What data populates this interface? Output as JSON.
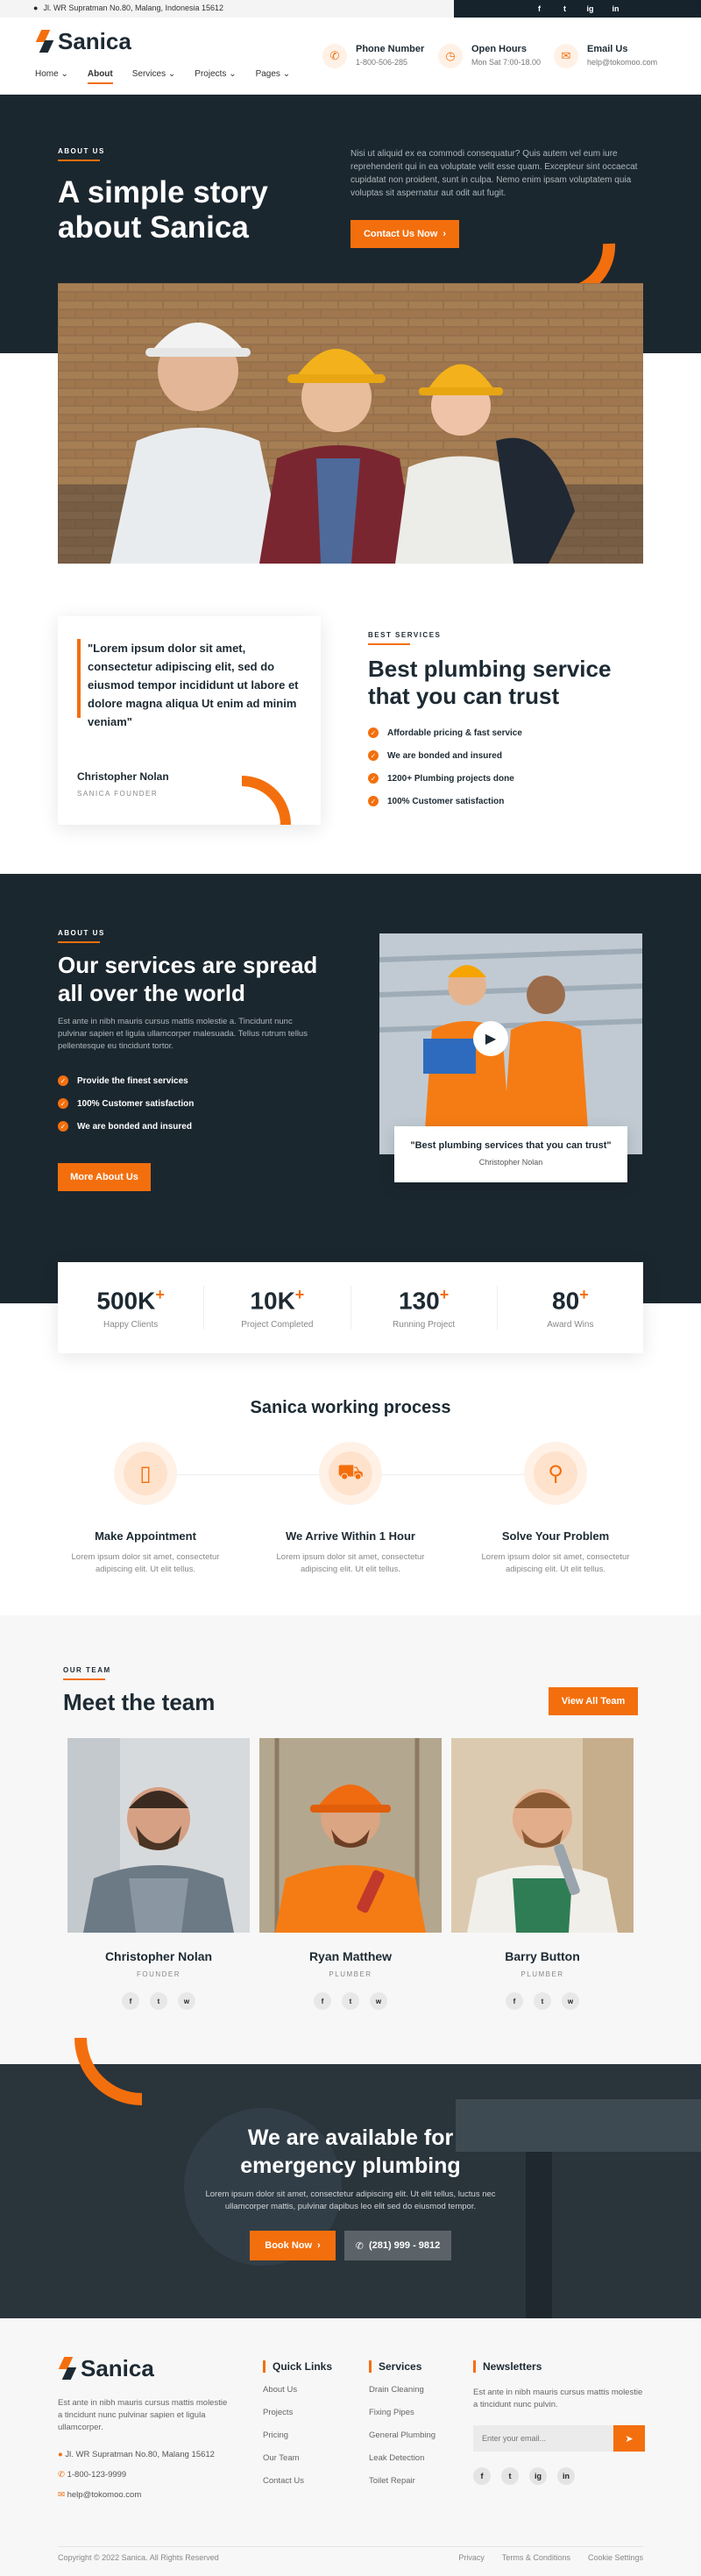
{
  "topbar": {
    "address": "Jl. WR Supratman No.80, Malang, Indonesia 15612",
    "social": [
      "f",
      "t",
      "ig",
      "in"
    ]
  },
  "brand": {
    "name": "Sanica"
  },
  "nav": {
    "items": [
      {
        "label": "Home",
        "caret": "⌄"
      },
      {
        "label": "About",
        "caret": ""
      },
      {
        "label": "Services",
        "caret": "⌄"
      },
      {
        "label": "Projects",
        "caret": "⌄"
      },
      {
        "label": "Pages",
        "caret": "⌄"
      }
    ]
  },
  "header_info": [
    {
      "title": "Phone Number",
      "value": "1-800-506-285",
      "icon": "phone-icon"
    },
    {
      "title": "Open Hours",
      "value": "Mon Sat 7:00-18.00",
      "icon": "clock-icon"
    },
    {
      "title": "Email Us",
      "value": "help@tokomoo.com",
      "icon": "mail-icon"
    }
  ],
  "hero": {
    "eyebrow": "ABOUT US",
    "title_l1": "A simple story",
    "title_l2": "about Sanica",
    "text": "Nisi ut aliquid ex ea commodi consequatur? Quis autem vel eum iure reprehenderit qui in ea voluptate velit esse quam. Excepteur sint occaecat cupidatat non proident, sunt in culpa. Nemo enim ipsam voluptatem quia voluptas sit aspernatur aut odit aut fugit.",
    "button": "Contact Us Now",
    "arrow": "›"
  },
  "quote": {
    "text": "\"Lorem ipsum dolor sit amet, consectetur adipiscing elit, sed do eiusmod tempor incididunt ut labore et dolore magna aliqua Ut enim ad minim veniam\"",
    "name": "Christopher Nolan",
    "role": "SANICA FOUNDER"
  },
  "best": {
    "eyebrow": "BEST SERVICES",
    "title_l1": "Best plumbing service",
    "title_l2": "that you can trust",
    "items": [
      "Affordable pricing & fast service",
      "We are bonded and insured",
      "1200+ Plumbing projects done",
      "100% Customer satisfaction"
    ]
  },
  "services": {
    "eyebrow": "ABOUT US",
    "title_l1": "Our services are spread",
    "title_l2": "all over the world",
    "text": "Est ante in nibh mauris cursus mattis molestie a. Tincidunt nunc pulvinar sapien et ligula ullamcorper malesuada. Tellus rutrum tellus pellentesque eu tincidunt tortor.",
    "items": [
      "Provide the finest services",
      "100% Customer satisfaction",
      "We are bonded and insured"
    ],
    "button": "More About Us",
    "video_quote": "\"Best plumbing services that you can trust\"",
    "video_name": "Christopher Nolan"
  },
  "stats": [
    {
      "value": "500K",
      "label": "Happy Clients"
    },
    {
      "value": "10K",
      "label": "Project Completed"
    },
    {
      "value": "130",
      "label": "Running Project"
    },
    {
      "value": "80",
      "label": "Award Wins"
    }
  ],
  "stat_plus": "+",
  "process": {
    "title": "Sanica working process",
    "steps": [
      {
        "title": "Make Appointment",
        "text_l1": "Lorem ipsum dolor sit amet, consectetur",
        "text_l2": "adipiscing elit. Ut elit tellus.",
        "icon": "phone-icon"
      },
      {
        "title": "We Arrive Within 1 Hour",
        "text_l1": "Lorem ipsum dolor sit amet, consectetur",
        "text_l2": "adipiscing elit. Ut elit tellus.",
        "icon": "truck-icon"
      },
      {
        "title": "Solve Your Problem",
        "text_l1": "Lorem ipsum dolor sit amet, consectetur",
        "text_l2": "adipiscing elit. Ut elit tellus.",
        "icon": "faucet-icon"
      }
    ]
  },
  "team": {
    "eyebrow": "OUR TEAM",
    "title": "Meet the team",
    "button": "View All Team",
    "members": [
      {
        "name": "Christopher Nolan",
        "role": "FOUNDER"
      },
      {
        "name": "Ryan Matthew",
        "role": "PLUMBER"
      },
      {
        "name": "Barry Button",
        "role": "PLUMBER"
      }
    ],
    "social": [
      "f",
      "t",
      "w"
    ]
  },
  "emergency": {
    "title_l1": "We are available for",
    "title_l2": "emergency plumbing",
    "text_l1": "Lorem ipsum dolor sit amet, consectetur adipiscing elit. Ut elit tellus, luctus nec",
    "text_l2": "ullamcorper mattis, pulvinar dapibus leo elit sed do eiusmod tempor.",
    "book": "Book Now",
    "phone": "(281) 999 - 9812",
    "arrow": "›",
    "phone_glyph": "✆"
  },
  "footer": {
    "about": "Est ante in nibh mauris cursus mattis molestie a tincidunt nunc pulvinar sapien et ligula ullamcorper.",
    "address": "Jl. WR Supratman No.80, Malang 15612",
    "phone": "1-800-123-9999",
    "email": "help@tokomoo.com",
    "quick_title": "Quick Links",
    "quick": [
      "About Us",
      "Projects",
      "Pricing",
      "Our Team",
      "Contact Us"
    ],
    "services_title": "Services",
    "services": [
      "Drain Cleaning",
      "Fixing Pipes",
      "General Plumbing",
      "Leak Detection",
      "Toilet Repair"
    ],
    "news_title": "Newsletters",
    "news_text": "Est ante in nibh mauris cursus mattis molestie a tincidunt nunc pulvin.",
    "news_placeholder": "Enter your email...",
    "social": [
      "f",
      "t",
      "ig",
      "in"
    ],
    "copyright": "Copyright © 2022 Sanica. All Rights Reserved",
    "links": [
      "Privacy",
      "Terms & Conditions",
      "Cookie Settings"
    ]
  }
}
